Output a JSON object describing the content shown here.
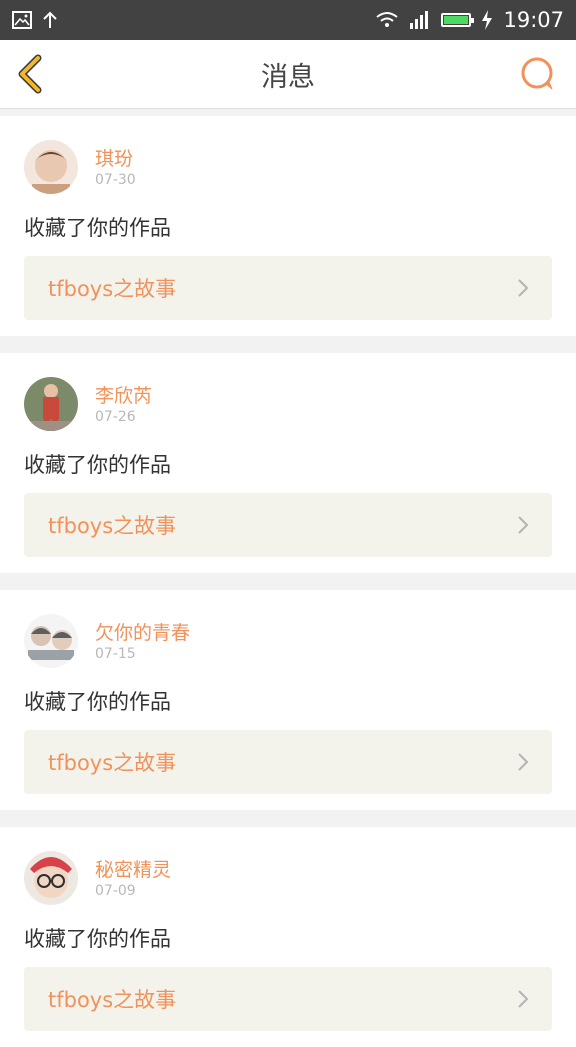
{
  "status_bar": {
    "time": "19:07"
  },
  "header": {
    "title": "消息"
  },
  "messages": [
    {
      "name": "琪玢",
      "date": "07-30",
      "text": "收藏了你的作品",
      "work": "tfboys之故事",
      "avatar_color": "#caa07e"
    },
    {
      "name": "李欣芮",
      "date": "07-26",
      "text": "收藏了你的作品",
      "work": "tfboys之故事",
      "avatar_color": "#c94a3b"
    },
    {
      "name": "欠你的青春",
      "date": "07-15",
      "text": "收藏了你的作品",
      "work": "tfboys之故事",
      "avatar_color": "#9aa2a8"
    },
    {
      "name": "秘密精灵",
      "date": "07-09",
      "text": "收藏了你的作品",
      "work": "tfboys之故事",
      "avatar_color": "#d7424a"
    }
  ],
  "colors": {
    "accent": "#f0925a",
    "back": "#f3b728",
    "status_bar": "#424242"
  }
}
